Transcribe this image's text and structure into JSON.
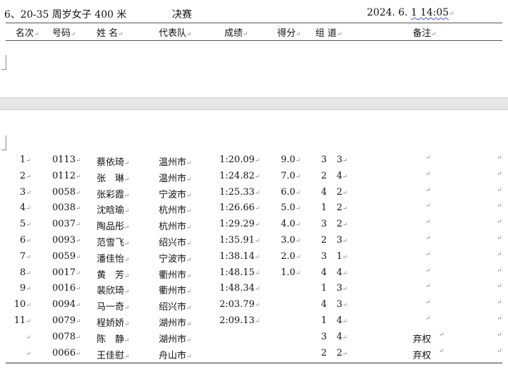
{
  "header": {
    "event": "6、20-35 周岁女子 400 米",
    "stage": "决赛",
    "datetime_a": "2024. 6. ",
    "datetime_b": "1",
    "datetime_c": " 14:05"
  },
  "columns": {
    "rank": "名次",
    "bib": "号码",
    "name": "姓 名",
    "team": "代表队",
    "result": "成绩",
    "points": "得分",
    "group_lane": "组 道",
    "note": "备注"
  },
  "paragraph_mark": "↵",
  "rows": [
    {
      "rank": "1",
      "bib": "0113",
      "name": "蔡依琦",
      "team": "温州市",
      "result": "1:20.09",
      "points": "9.0",
      "group": "3",
      "lane": "3",
      "note": ""
    },
    {
      "rank": "2",
      "bib": "0112",
      "name": "张　琳",
      "team": "温州市",
      "result": "1:24.82",
      "points": "7.0",
      "group": "2",
      "lane": "4",
      "note": ""
    },
    {
      "rank": "3",
      "bib": "0058",
      "name": "张彩霞",
      "team": "宁波市",
      "result": "1:25.33",
      "points": "6.0",
      "group": "4",
      "lane": "2",
      "note": ""
    },
    {
      "rank": "4",
      "bib": "0038",
      "name": "沈晗瑜",
      "team": "杭州市",
      "result": "1:26.66",
      "points": "5.0",
      "group": "1",
      "lane": "2",
      "note": ""
    },
    {
      "rank": "5",
      "bib": "0037",
      "name": "陶品彤",
      "team": "杭州市",
      "result": "1:29.29",
      "points": "4.0",
      "group": "3",
      "lane": "2",
      "note": ""
    },
    {
      "rank": "6",
      "bib": "0093",
      "name": "范雪飞",
      "team": "绍兴市",
      "result": "1:35.91",
      "points": "3.0",
      "group": "2",
      "lane": "3",
      "note": ""
    },
    {
      "rank": "7",
      "bib": "0059",
      "name": "潘佳怡",
      "team": "宁波市",
      "result": "1:38.14",
      "points": "2.0",
      "group": "3",
      "lane": "1",
      "note": ""
    },
    {
      "rank": "8",
      "bib": "0017",
      "name": "黄　芳",
      "team": "衢州市",
      "result": "1:48.15",
      "points": "1.0",
      "group": "4",
      "lane": "4",
      "note": ""
    },
    {
      "rank": "9",
      "bib": "0016",
      "name": "裴欣琦",
      "team": "衢州市",
      "result": "1:48.34",
      "points": "",
      "group": "1",
      "lane": "3",
      "note": ""
    },
    {
      "rank": "10",
      "bib": "0094",
      "name": "马一奇",
      "team": "绍兴市",
      "result": "2:03.79",
      "points": "",
      "group": "4",
      "lane": "3",
      "note": ""
    },
    {
      "rank": "11",
      "bib": "0079",
      "name": "程娇娇",
      "team": "湖州市",
      "result": "2:09.13",
      "points": "",
      "group": "1",
      "lane": "4",
      "note": ""
    },
    {
      "rank": "",
      "bib": "0078",
      "name": "陈　静",
      "team": "湖州市",
      "result": "",
      "points": "",
      "group": "3",
      "lane": "4",
      "note": "弃权"
    },
    {
      "rank": "",
      "bib": "0066",
      "name": "王佳慰",
      "team": "舟山市",
      "result": "",
      "points": "",
      "group": "2",
      "lane": "2",
      "note": "弃权"
    }
  ]
}
